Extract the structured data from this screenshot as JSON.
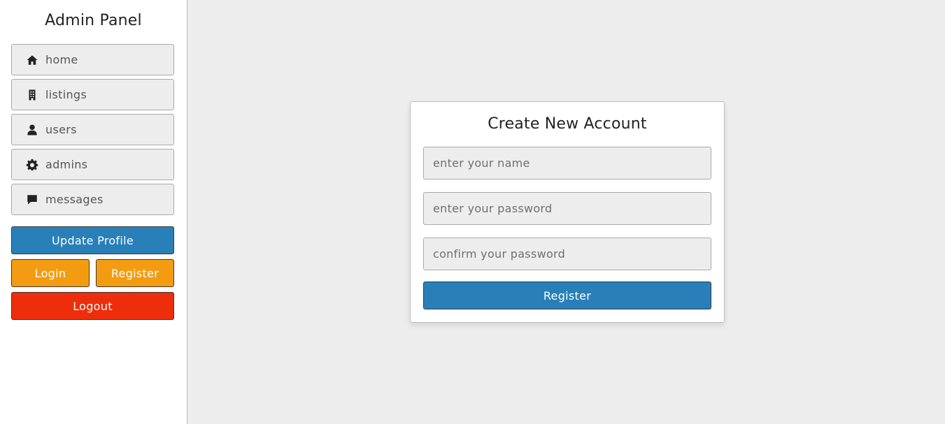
{
  "sidebar": {
    "title": "Admin Panel",
    "items": [
      {
        "label": "home",
        "icon": "home-icon"
      },
      {
        "label": "listings",
        "icon": "building-icon"
      },
      {
        "label": "users",
        "icon": "user-icon"
      },
      {
        "label": "admins",
        "icon": "gear-icon"
      },
      {
        "label": "messages",
        "icon": "message-icon"
      }
    ],
    "update_profile_label": "Update Profile",
    "login_label": "Login",
    "register_label": "Register",
    "logout_label": "Logout"
  },
  "form": {
    "title": "Create New Account",
    "name_placeholder": "enter your name",
    "password_placeholder": "enter your password",
    "confirm_placeholder": "confirm your password",
    "name_value": "",
    "password_value": "",
    "confirm_value": "",
    "submit_label": "Register"
  },
  "colors": {
    "primary_blue": "#2980b9",
    "orange": "#f39c12",
    "red": "#ee2d0a",
    "background": "#ededed"
  }
}
